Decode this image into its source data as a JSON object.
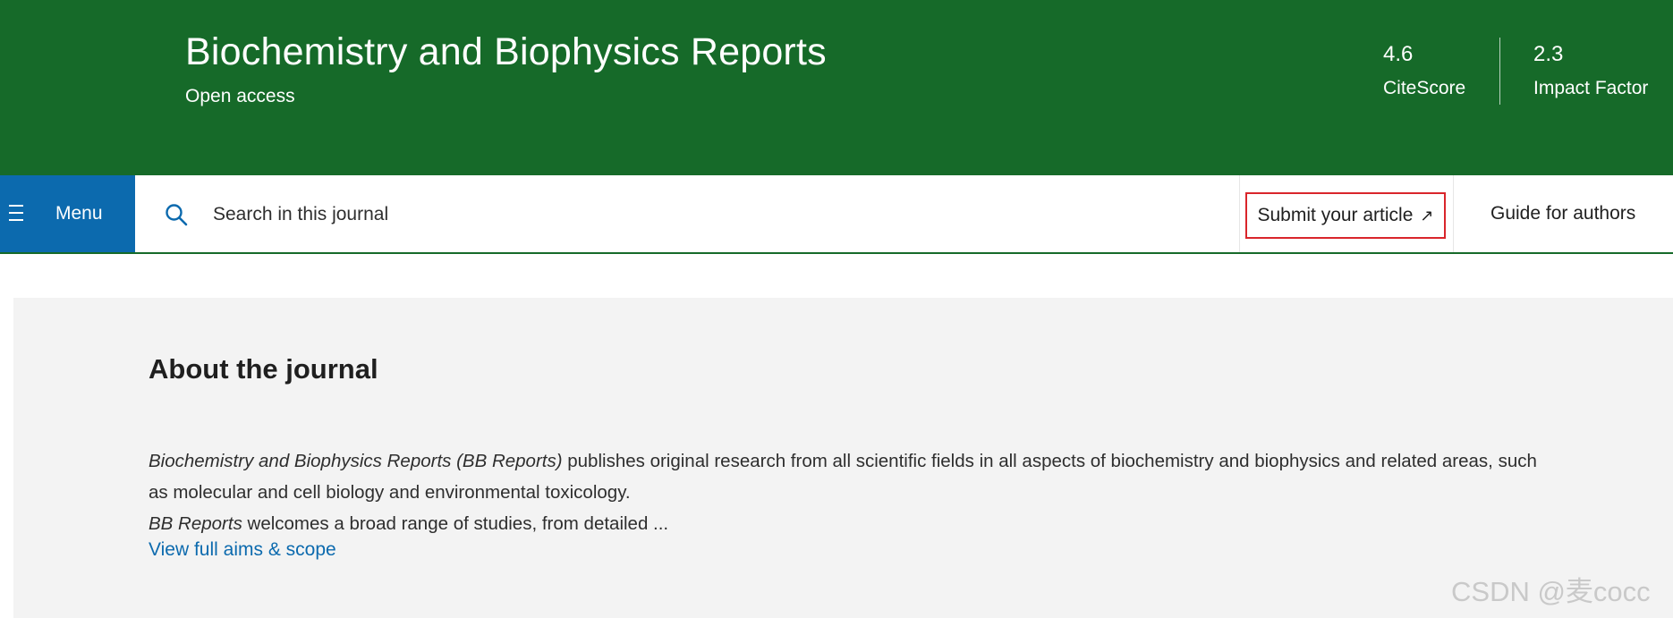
{
  "header": {
    "title": "Biochemistry and Biophysics Reports",
    "subtitle": "Open access",
    "metrics": [
      {
        "value": "4.6",
        "label": "CiteScore"
      },
      {
        "value": "2.3",
        "label": "Impact Factor"
      }
    ],
    "background_color": "#166a29"
  },
  "nav": {
    "menu_label": "Menu",
    "search_placeholder": "Search in this journal",
    "submit_label": "Submit your article",
    "submit_arrow": "↗",
    "guide_label": "Guide for authors",
    "menu_color": "#0c6aae",
    "submit_highlight_color": "#d9252b"
  },
  "about": {
    "heading": "About the journal",
    "para1_italic": "Biochemistry and Biophysics Reports (BB Reports)",
    "para1_rest": " publishes original research from all scientific fields in all aspects of biochemistry and biophysics and related areas, such as molecular and cell biology and environmental toxicology.",
    "para2_italic": "BB Reports",
    "para2_rest": " welcomes a broad range of studies, from detailed ...",
    "link_label": "View full aims & scope"
  },
  "watermark": "CSDN @麦cocc"
}
